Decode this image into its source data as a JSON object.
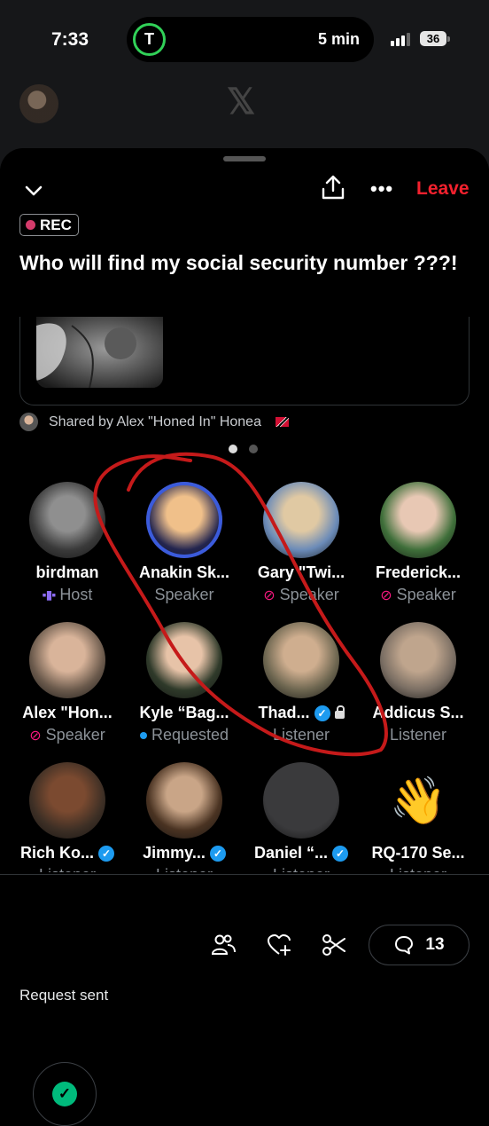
{
  "status_bar": {
    "time": "7:33",
    "live_activity_text": "5 min",
    "live_activity_logo": "T",
    "battery": "36"
  },
  "space": {
    "leave_label": "Leave",
    "rec_label": "REC",
    "title": "Who will find my social security number ???!",
    "shared_by": "Shared by Alex \"Honed In\" Honea"
  },
  "participants": [
    {
      "name": "birdman",
      "role": "Host",
      "role_icon": "host-bars-icon",
      "colors": [
        "#8f8f8f",
        "#3a3a3a"
      ]
    },
    {
      "name": "Anakin Sk...",
      "role": "Speaker",
      "role_icon": "",
      "ring": "#3b5bdb",
      "colors": [
        "#f0c08a",
        "#23254f"
      ]
    },
    {
      "name": "Gary \"Twi...",
      "role": "Speaker",
      "role_icon": "mic-off-icon",
      "colors": [
        "#e0c9a3",
        "#6b8bb8"
      ]
    },
    {
      "name": "Frederick...",
      "role": "Speaker",
      "role_icon": "mic-off-icon",
      "colors": [
        "#e8c8b4",
        "#3f6f3a"
      ]
    },
    {
      "name": "Alex \"Hon...",
      "role": "Speaker",
      "role_icon": "mic-off-icon",
      "colors": [
        "#d9b49a",
        "#6b5a4c"
      ]
    },
    {
      "name": "Kyle “Bag...",
      "role": "Requested",
      "role_icon": "requested-dot-icon",
      "colors": [
        "#e7c3a8",
        "#2f3a2a"
      ]
    },
    {
      "name": "Thad...",
      "role": "Listener",
      "role_icon": "",
      "verified": true,
      "locked": true,
      "colors": [
        "#cfae8f",
        "#6d6650"
      ]
    },
    {
      "name": "Addicus S...",
      "role": "Listener",
      "role_icon": "",
      "colors": [
        "#bfa58d",
        "#7a6e63"
      ]
    },
    {
      "name": "Rich Ko...",
      "role": "Listener",
      "role_icon": "",
      "verified": true,
      "colors": [
        "#7b4a30",
        "#3d2f25"
      ]
    },
    {
      "name": "Jimmy...",
      "role": "Listener",
      "role_icon": "",
      "verified": true,
      "colors": [
        "#c9a587",
        "#4a3322"
      ]
    },
    {
      "name": "Daniel “...",
      "role": "Listener",
      "role_icon": "",
      "verified": true,
      "colors": [
        "#3a3a3c",
        "#3a3a3c"
      ]
    },
    {
      "name": "RQ-170 Se...",
      "role": "Listener",
      "role_icon": "",
      "emoji": "👋",
      "colors": [
        "#000000",
        "#000000"
      ]
    }
  ],
  "bottom": {
    "request_label": "Request sent",
    "comment_count": "13"
  },
  "accent": {
    "leave": "#f4212e",
    "rec_dot": "#d43b6b",
    "check": "#00ba7c",
    "verified": "#1d9bf0",
    "annotation": "#c51a1a"
  }
}
